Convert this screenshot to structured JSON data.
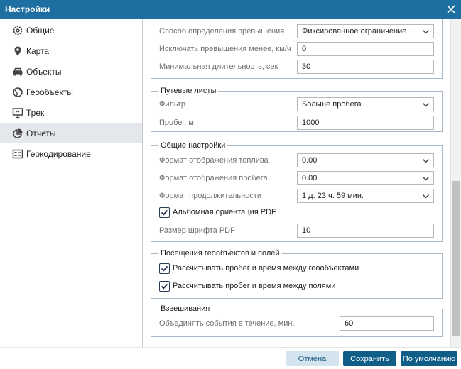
{
  "window": {
    "title": "Настройки"
  },
  "sidebar": {
    "items": [
      {
        "label": "Общие",
        "icon": "gear-icon"
      },
      {
        "label": "Карта",
        "icon": "map-pin-icon"
      },
      {
        "label": "Объекты",
        "icon": "car-icon"
      },
      {
        "label": "Геообъекты",
        "icon": "globe-icon"
      },
      {
        "label": "Трек",
        "icon": "track-icon"
      },
      {
        "label": "Отчеты",
        "icon": "pie-chart-icon"
      },
      {
        "label": "Геокодирование",
        "icon": "geocoding-icon"
      }
    ],
    "active_index": 5
  },
  "speeding": {
    "method_label": "Способ определения превышения",
    "method_value": "Фиксированное ограничение",
    "exclude_label": "Исключать превышения менее, км/ч",
    "exclude_value": "0",
    "min_duration_label": "Минимальная длительность, сек",
    "min_duration_value": "30"
  },
  "waybills": {
    "legend": "Путевые листы",
    "filter_label": "Фильтр",
    "filter_value": "Больше пробега",
    "mileage_label": "Пробег, м",
    "mileage_value": "1000"
  },
  "general": {
    "legend": "Общие настройки",
    "fuel_format_label": "Формат отображения топлива",
    "fuel_format_value": "0.00",
    "mileage_format_label": "Формат отображения пробега",
    "mileage_format_value": "0.00",
    "duration_format_label": "Формат продолжительности",
    "duration_format_value": "1 д. 23 ч. 59 мин.",
    "landscape_label": "Альбомная ориентация PDF",
    "landscape_checked": true,
    "font_size_label": "Размер шрифта PDF",
    "font_size_value": "10"
  },
  "visits": {
    "legend": "Посещения геообъектов и полей",
    "geo_label": "Рассчитывать пробег и время между геообъектами",
    "geo_checked": true,
    "fields_label": "Рассчитывать пробег и время между полями",
    "fields_checked": true
  },
  "weighing": {
    "legend": "Взвешивания",
    "merge_label": "Объединять события в течение, мин.",
    "merge_value": "60"
  },
  "footer": {
    "cancel_label": "Отмена",
    "save_label": "Сохранить",
    "default_label": "По умолчанию"
  },
  "colors": {
    "titlebar": "#1c6fa0",
    "primary_button": "#0f5e88",
    "secondary_button": "#d4e4ef",
    "active_nav": "#e4e7ec"
  }
}
